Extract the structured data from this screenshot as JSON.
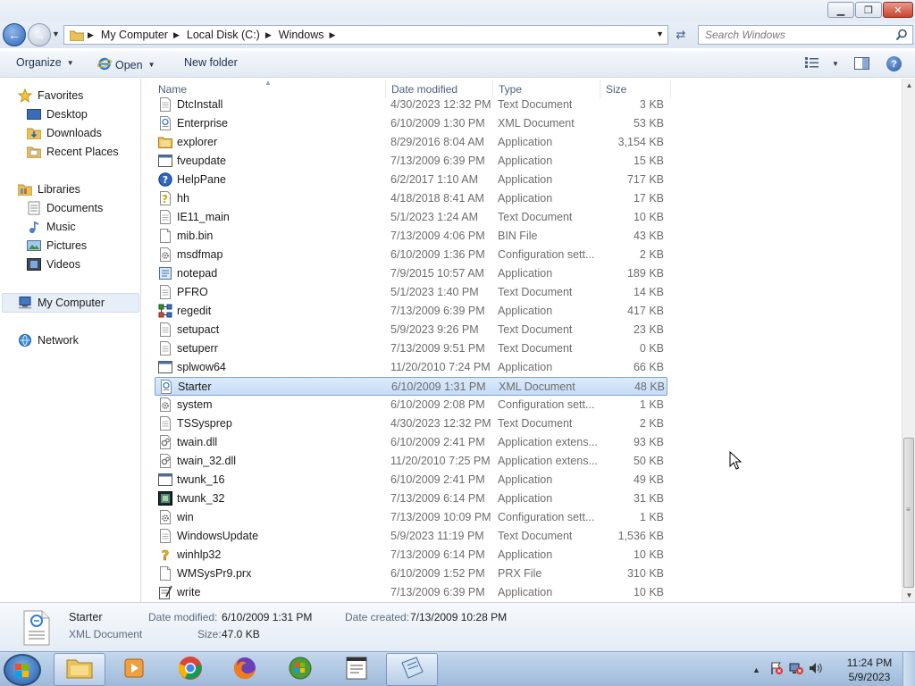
{
  "window": {
    "minimize_glyph": "▁",
    "maximize_glyph": "❐",
    "close_glyph": "✕"
  },
  "address": {
    "breadcrumbs": [
      "My Computer",
      "Local Disk (C:)",
      "Windows"
    ],
    "search_placeholder": "Search Windows"
  },
  "toolbar": {
    "organize_label": "Organize",
    "open_label": "Open",
    "newfolder_label": "New folder",
    "help_label": "?"
  },
  "navpane": {
    "favorites": "Favorites",
    "desktop": "Desktop",
    "downloads": "Downloads",
    "recent": "Recent Places",
    "libraries": "Libraries",
    "documents": "Documents",
    "music": "Music",
    "pictures": "Pictures",
    "videos": "Videos",
    "mycomputer": "My Computer",
    "network": "Network"
  },
  "columns": {
    "name": "Name",
    "date": "Date modified",
    "type": "Type",
    "size": "Size"
  },
  "files": [
    {
      "name": "DtcInstall",
      "date": "4/30/2023 12:32 PM",
      "type": "Text Document",
      "size": "3 KB",
      "icon": "text-file-icon"
    },
    {
      "name": "Enterprise",
      "date": "6/10/2009 1:30 PM",
      "type": "XML Document",
      "size": "53 KB",
      "icon": "xml-file-icon"
    },
    {
      "name": "explorer",
      "date": "8/29/2016 8:04 AM",
      "type": "Application",
      "size": "3,154 KB",
      "icon": "explorer-folder-icon"
    },
    {
      "name": "fveupdate",
      "date": "7/13/2009 6:39 PM",
      "type": "Application",
      "size": "15 KB",
      "icon": "app-window-icon"
    },
    {
      "name": "HelpPane",
      "date": "6/2/2017 1:10 AM",
      "type": "Application",
      "size": "717 KB",
      "icon": "help-circle-icon"
    },
    {
      "name": "hh",
      "date": "4/18/2018 8:41 AM",
      "type": "Application",
      "size": "17 KB",
      "icon": "help-document-icon"
    },
    {
      "name": "IE11_main",
      "date": "5/1/2023 1:24 AM",
      "type": "Text Document",
      "size": "10 KB",
      "icon": "text-file-icon"
    },
    {
      "name": "mib.bin",
      "date": "7/13/2009 4:06 PM",
      "type": "BIN File",
      "size": "43 KB",
      "icon": "blank-file-icon"
    },
    {
      "name": "msdfmap",
      "date": "6/10/2009 1:36 PM",
      "type": "Configuration sett...",
      "size": "2 KB",
      "icon": "config-file-icon"
    },
    {
      "name": "notepad",
      "date": "7/9/2015 10:57 AM",
      "type": "Application",
      "size": "189 KB",
      "icon": "notepad-icon"
    },
    {
      "name": "PFRO",
      "date": "5/1/2023 1:40 PM",
      "type": "Text Document",
      "size": "14 KB",
      "icon": "text-file-icon"
    },
    {
      "name": "regedit",
      "date": "7/13/2009 6:39 PM",
      "type": "Application",
      "size": "417 KB",
      "icon": "regedit-icon"
    },
    {
      "name": "setupact",
      "date": "5/9/2023 9:26 PM",
      "type": "Text Document",
      "size": "23 KB",
      "icon": "text-file-icon"
    },
    {
      "name": "setuperr",
      "date": "7/13/2009 9:51 PM",
      "type": "Text Document",
      "size": "0 KB",
      "icon": "text-file-icon"
    },
    {
      "name": "splwow64",
      "date": "11/20/2010 7:24 PM",
      "type": "Application",
      "size": "66 KB",
      "icon": "app-window-icon"
    },
    {
      "name": "Starter",
      "date": "6/10/2009 1:31 PM",
      "type": "XML Document",
      "size": "48 KB",
      "icon": "xml-file-icon"
    },
    {
      "name": "system",
      "date": "6/10/2009 2:08 PM",
      "type": "Configuration sett...",
      "size": "1 KB",
      "icon": "config-file-icon"
    },
    {
      "name": "TSSysprep",
      "date": "4/30/2023 12:32 PM",
      "type": "Text Document",
      "size": "2 KB",
      "icon": "text-file-icon"
    },
    {
      "name": "twain.dll",
      "date": "6/10/2009 2:41 PM",
      "type": "Application extens...",
      "size": "93 KB",
      "icon": "dll-file-icon"
    },
    {
      "name": "twain_32.dll",
      "date": "11/20/2010 7:25 PM",
      "type": "Application extens...",
      "size": "50 KB",
      "icon": "dll-file-icon"
    },
    {
      "name": "twunk_16",
      "date": "6/10/2009 2:41 PM",
      "type": "Application",
      "size": "49 KB",
      "icon": "app-window-icon"
    },
    {
      "name": "twunk_32",
      "date": "7/13/2009 6:14 PM",
      "type": "Application",
      "size": "31 KB",
      "icon": "scanner-app-icon"
    },
    {
      "name": "win",
      "date": "7/13/2009 10:09 PM",
      "type": "Configuration sett...",
      "size": "1 KB",
      "icon": "config-file-icon"
    },
    {
      "name": "WindowsUpdate",
      "date": "5/9/2023 11:19 PM",
      "type": "Text Document",
      "size": "1,536 KB",
      "icon": "text-file-icon"
    },
    {
      "name": "winhlp32",
      "date": "7/13/2009 6:14 PM",
      "type": "Application",
      "size": "10 KB",
      "icon": "help-question-icon"
    },
    {
      "name": "WMSysPr9.prx",
      "date": "6/10/2009 1:52 PM",
      "type": "PRX File",
      "size": "310 KB",
      "icon": "blank-file-icon"
    },
    {
      "name": "write",
      "date": "7/13/2009 6:39 PM",
      "type": "Application",
      "size": "10 KB",
      "icon": "wordpad-icon"
    }
  ],
  "selected_index": 15,
  "details": {
    "filename": "Starter",
    "filetype": "XML Document",
    "modified_label": "Date modified:",
    "modified_value": "6/10/2009 1:31 PM",
    "created_label": "Date created:",
    "created_value": "7/13/2009 10:28 PM",
    "size_label": "Size:",
    "size_value": "47.0 KB"
  },
  "taskbar": {
    "time": "11:24 PM",
    "date": "5/9/2023"
  },
  "colors": {
    "selection": "#cce1f8",
    "accent": "#2d63b4"
  }
}
